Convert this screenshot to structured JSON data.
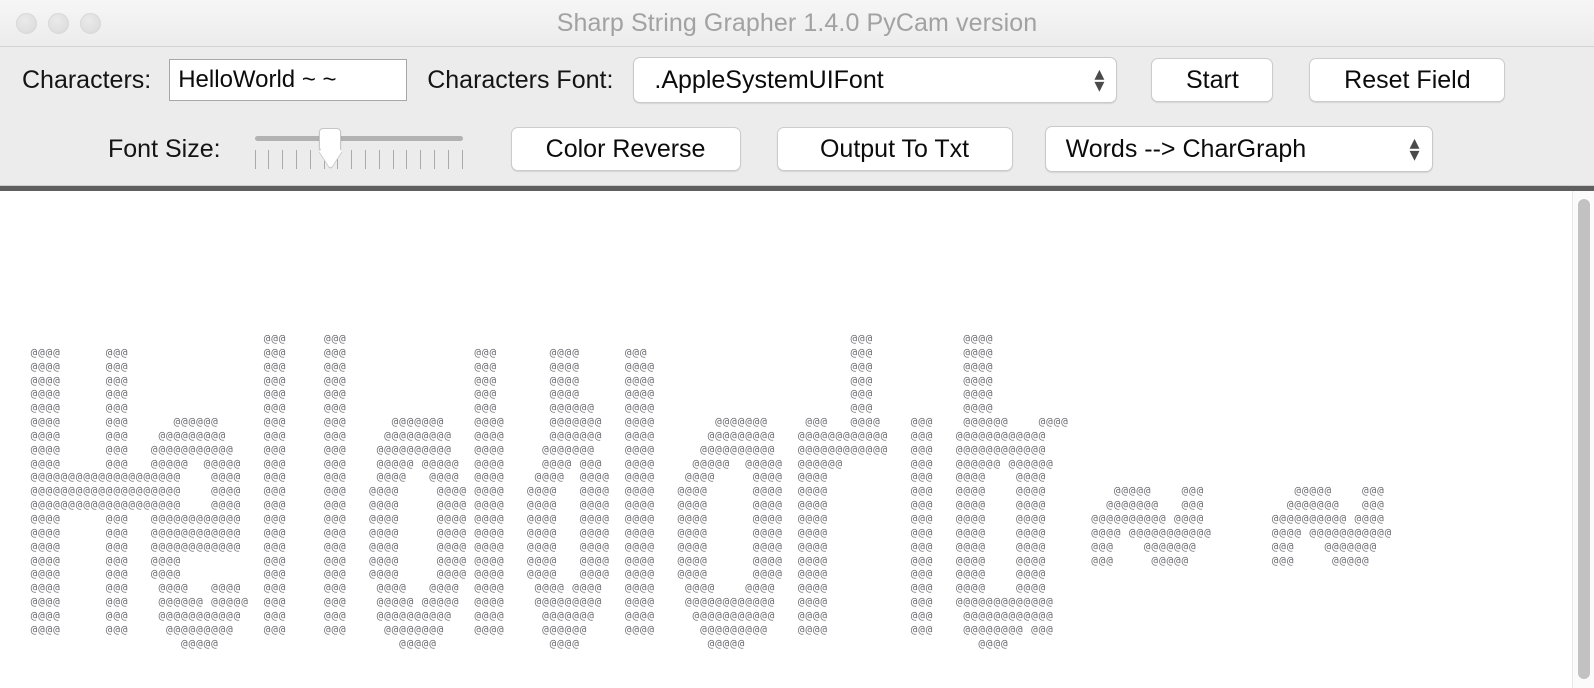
{
  "window": {
    "title": "Sharp String Grapher 1.4.0 PyCam version",
    "traffic_lights": [
      "close",
      "minimize",
      "zoom"
    ]
  },
  "toolbar": {
    "characters_label": "Characters:",
    "characters_value": "HelloWorld ~ ~",
    "characters_placeholder": "HelloWorld ~ ~",
    "characters_font_label": "Characters Font:",
    "characters_font_value": ".AppleSystemUIFont",
    "start_label": "Start",
    "reset_label": "Reset Field",
    "font_size_label": "Font Size:",
    "font_size_ticks": 16,
    "font_size_position": 6,
    "color_reverse_label": "Color Reverse",
    "output_to_txt_label": "Output To Txt",
    "mode_value": "Words --> CharGraph",
    "chevron_up": "▴",
    "chevron_down": "▾"
  },
  "canvas": {
    "glyph": "@",
    "text_color": "#6e6e73",
    "background": "#ffffff",
    "ascii_art": "                                  @@@     @@@                                                                   @@@            @@@@\n   @@@@      @@@                  @@@     @@@                 @@@       @@@@      @@@                           @@@            @@@@\n   @@@@      @@@                  @@@     @@@                 @@@       @@@@      @@@@                          @@@            @@@@\n   @@@@      @@@                  @@@     @@@                 @@@       @@@@      @@@@                          @@@            @@@@\n   @@@@      @@@                  @@@     @@@                 @@@       @@@@      @@@@                          @@@            @@@@\n   @@@@      @@@                  @@@     @@@                 @@@       @@@@@@    @@@@                          @@@            @@@@\n   @@@@      @@@      @@@@@@      @@@     @@@      @@@@@@@    @@@@      @@@@@@@   @@@@        @@@@@@@     @@@   @@@@    @@@    @@@@@@    @@@@\n   @@@@      @@@    @@@@@@@@@     @@@     @@@     @@@@@@@@@   @@@@      @@@@@@@   @@@@       @@@@@@@@@   @@@@@@@@@@@@   @@@   @@@@@@@@@@@@\n   @@@@      @@@   @@@@@@@@@@@    @@@     @@@    @@@@@@@@@@   @@@@     @@@@@@@    @@@@      @@@@@@@@@@   @@@@@@@@@@@@   @@@   @@@@@@@@@@@@\n   @@@@      @@@   @@@@@  @@@@@   @@@     @@@    @@@@@ @@@@@  @@@@     @@@@ @@@   @@@@     @@@@@  @@@@@  @@@@@@         @@@   @@@@@@ @@@@@@\n   @@@@@@@@@@@@@@@@@@@@    @@@@   @@@     @@@    @@@@   @@@@  @@@@    @@@@  @@@@  @@@@    @@@@     @@@@  @@@@           @@@   @@@@    @@@@\n   @@@@@@@@@@@@@@@@@@@@    @@@@   @@@     @@@   @@@@     @@@@ @@@@   @@@@   @@@@  @@@@   @@@@      @@@@  @@@@           @@@   @@@@    @@@@         @@@@@    @@@            @@@@@    @@@\n   @@@@@@@@@@@@@@@@@@@@    @@@@   @@@     @@@   @@@@     @@@@ @@@@   @@@@   @@@@  @@@@   @@@@      @@@@  @@@@           @@@   @@@@    @@@@        @@@@@@@   @@@           @@@@@@@   @@@\n   @@@@      @@@   @@@@@@@@@@@@   @@@     @@@   @@@@     @@@@ @@@@   @@@@   @@@@  @@@@   @@@@      @@@@  @@@@           @@@   @@@@    @@@@      @@@@@@@@@@ @@@@         @@@@@@@@@@ @@@@\n   @@@@      @@@   @@@@@@@@@@@@   @@@     @@@   @@@@     @@@@ @@@@   @@@@   @@@@  @@@@   @@@@      @@@@  @@@@           @@@   @@@@    @@@@      @@@@ @@@@@@@@@@@        @@@@ @@@@@@@@@@@\n   @@@@      @@@   @@@@@@@@@@@@   @@@     @@@   @@@@     @@@@ @@@@   @@@@   @@@@  @@@@   @@@@      @@@@  @@@@           @@@   @@@@    @@@@      @@@    @@@@@@@          @@@    @@@@@@@\n   @@@@      @@@   @@@@           @@@     @@@   @@@@     @@@@ @@@@   @@@@   @@@@  @@@@   @@@@      @@@@  @@@@           @@@   @@@@    @@@@      @@@     @@@@@           @@@     @@@@@\n   @@@@      @@@   @@@@           @@@     @@@   @@@@     @@@@ @@@@   @@@@   @@@@  @@@@   @@@@      @@@@  @@@@           @@@   @@@@    @@@@\n   @@@@      @@@    @@@@   @@@@   @@@     @@@    @@@@   @@@@  @@@@    @@@@ @@@@   @@@@    @@@@    @@@@   @@@@           @@@   @@@@    @@@@\n   @@@@      @@@    @@@@@@ @@@@@  @@@     @@@    @@@@@ @@@@@  @@@@    @@@@@@@@@   @@@@    @@@@@@@@@@@@   @@@@           @@@   @@@@@@@@@@@@@\n   @@@@      @@@    @@@@@@@@@@@   @@@     @@@    @@@@@@@@@@   @@@@     @@@@@@@    @@@@     @@@@@@@@@@@   @@@@           @@@    @@@@@@@@@@@@\n   @@@@      @@@     @@@@@@@@@    @@@     @@@     @@@@@@@@    @@@@     @@@@@@     @@@@      @@@@@@@@@    @@@@           @@@    @@@@@@@@ @@@\n                       @@@@@                        @@@@@               @@@@                 @@@@@                               @@@@"
  },
  "scrollbar": {
    "orientation": "vertical",
    "thumb_color": "#c2c2c2"
  }
}
